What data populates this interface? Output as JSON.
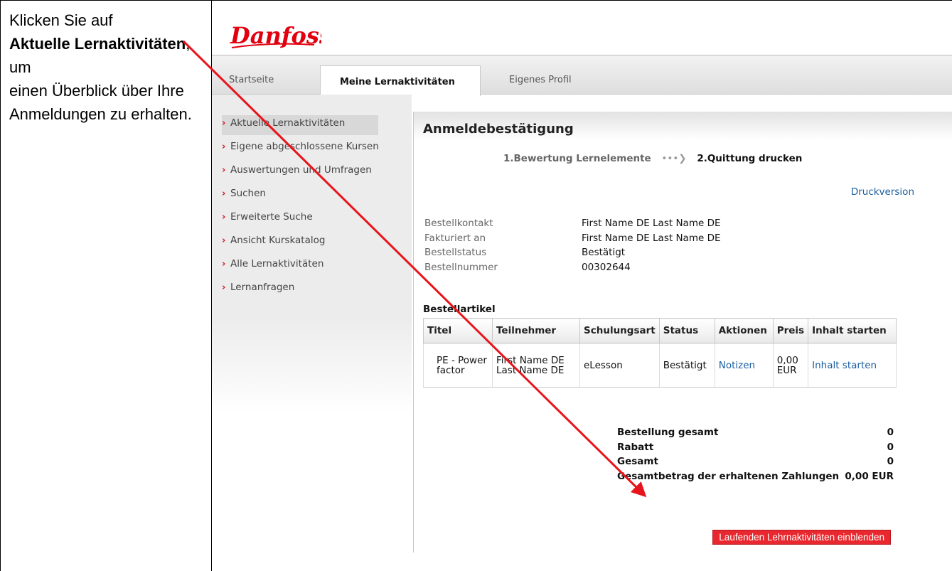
{
  "instruction": {
    "line1": "Klicken Sie auf",
    "bold": "Aktuelle Lernaktivitäten",
    "after_bold": ", um",
    "rest": "einen Überblick über Ihre Anmeldungen zu erhalten."
  },
  "brand": {
    "logo_text": "Danfoss",
    "accent": "#e2000f"
  },
  "tabs": [
    {
      "label": "Startseite"
    },
    {
      "label": "Meine Lernaktivitäten",
      "active": true
    },
    {
      "label": "Eigenes Profil"
    }
  ],
  "nav": {
    "items": [
      {
        "label": "Aktuelle Lernaktivitäten",
        "active": true
      },
      {
        "label": "Eigene abgeschlossene Kursen"
      },
      {
        "label": "Auswertungen und Umfragen"
      },
      {
        "label": "Suchen"
      },
      {
        "label": "Erweiterte Suche"
      },
      {
        "label": "Ansicht Kurskatalog"
      },
      {
        "label": "Alle Lernaktivitäten"
      },
      {
        "label": "Lernanfragen"
      }
    ]
  },
  "main": {
    "title": "Anmeldebestätigung",
    "step1": "1.Bewertung Lernelemente",
    "step2": "2.Quittung drucken",
    "print_link": "Druckversion",
    "info": [
      {
        "key": "Bestellkontakt",
        "value": "First Name DE Last Name DE"
      },
      {
        "key": "Fakturiert an",
        "value": "First Name DE Last Name DE"
      },
      {
        "key": "Bestellstatus",
        "value": "Bestätigt"
      },
      {
        "key": "Bestellnummer",
        "value": "00302644"
      }
    ],
    "items_title": "Bestellartikel",
    "table": {
      "headers": [
        "Titel",
        "Teilnehmer",
        "Schulungsart",
        "Status",
        "Aktionen",
        "Preis",
        "Inhalt starten"
      ],
      "row": {
        "titel": "PE - Power factor",
        "teilnehmer": "First Name DE Last Name DE",
        "schulungsart": "eLesson",
        "status": "Bestätigt",
        "aktion": "Notizen",
        "preis": "0,00 EUR",
        "inhalt": "Inhalt starten"
      }
    },
    "totals": [
      {
        "key": "Bestellung gesamt",
        "value": "0"
      },
      {
        "key": "Rabatt",
        "value": "0"
      },
      {
        "key": "Gesamt",
        "value": "0"
      },
      {
        "key": "Gesamtbetrag der erhaltenen Zahlungen",
        "value": "0,00 EUR"
      }
    ],
    "show_button": "Laufenden Lehrnaktivitäten einblenden"
  }
}
